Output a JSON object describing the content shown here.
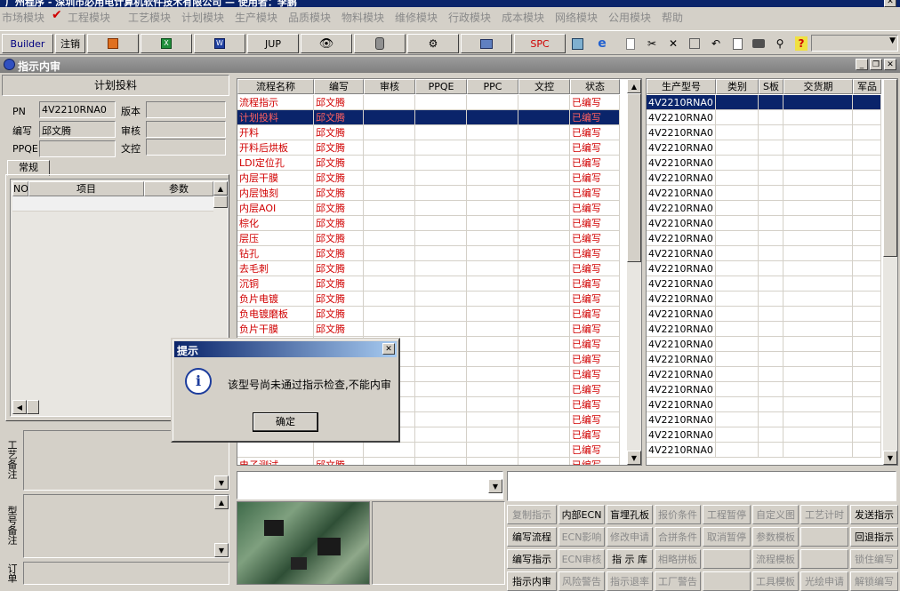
{
  "app": {
    "title": "广州程序 - 深圳市必用电计算机软件技术有限公司 — 使用者：李鹏"
  },
  "menu": [
    "市场模块",
    "工程模块",
    "工艺模块",
    "计划模块",
    "生产模块",
    "品质模块",
    "物料模块",
    "维修模块",
    "行政模块",
    "成本模块",
    "网络模块",
    "公用模块",
    "帮助"
  ],
  "toolbar": {
    "builder": "Builder",
    "logout": "注销",
    "jup": "JUP",
    "spc": "SPC",
    "combo_value": ""
  },
  "window": {
    "title": "指示内审"
  },
  "left": {
    "section_title": "计划投料",
    "pn_label": "PN",
    "pn_value": "4V2210RNA0",
    "version_label": "版本",
    "version_value": "",
    "writer_label": "编写",
    "writer_value": "邱文腾",
    "review_label": "审核",
    "review_value": "",
    "ppqe_label": "PPQE",
    "ppqe_value": "",
    "doc_label": "文控",
    "doc_value": "",
    "tab": "常规",
    "param_headers": [
      "NO",
      "项目",
      "参数"
    ],
    "craft_note_label": "工艺备注",
    "model_note_label": "型号备注",
    "order_note_label": "订单"
  },
  "flow": {
    "headers": [
      "流程名称",
      "编写",
      "审核",
      "PPQE",
      "PPC",
      "文控",
      "状态"
    ],
    "rows": [
      [
        "流程指示",
        "邱文腾",
        "已编写"
      ],
      [
        "计划投料",
        "邱文腾",
        "已编写"
      ],
      [
        "开料",
        "邱文腾",
        "已编写"
      ],
      [
        "开料后烘板",
        "邱文腾",
        "已编写"
      ],
      [
        "LDI定位孔",
        "邱文腾",
        "已编写"
      ],
      [
        "内层干膜",
        "邱文腾",
        "已编写"
      ],
      [
        "内层蚀刻",
        "邱文腾",
        "已编写"
      ],
      [
        "内层AOI",
        "邱文腾",
        "已编写"
      ],
      [
        "棕化",
        "邱文腾",
        "已编写"
      ],
      [
        "层压",
        "邱文腾",
        "已编写"
      ],
      [
        "钻孔",
        "邱文腾",
        "已编写"
      ],
      [
        "去毛刺",
        "邱文腾",
        "已编写"
      ],
      [
        "沉铜",
        "邱文腾",
        "已编写"
      ],
      [
        "负片电镀",
        "邱文腾",
        "已编写"
      ],
      [
        "负电镀磨板",
        "邱文腾",
        "已编写"
      ],
      [
        "负片干膜",
        "邱文腾",
        "已编写"
      ],
      [
        "",
        "",
        "已编写"
      ],
      [
        "",
        "",
        "已编写"
      ],
      [
        "",
        "",
        "已编写"
      ],
      [
        "",
        "",
        "已编写"
      ],
      [
        "",
        "",
        "已编写"
      ],
      [
        "",
        "",
        "已编写"
      ],
      [
        "",
        "",
        "已编写"
      ],
      [
        "",
        "",
        "已编写"
      ],
      [
        "电子测试",
        "邱文腾",
        "已编写"
      ]
    ],
    "selected_index": 1
  },
  "models": {
    "headers": [
      "生产型号",
      "类别",
      "S板",
      "交货期",
      "军品"
    ],
    "rows": [
      "4V2210RNA0",
      "4V2210RNA0",
      "4V2210RNA0",
      "4V2210RNA0",
      "4V2210RNA0",
      "4V2210RNA0",
      "4V2210RNA0",
      "4V2210RNA0",
      "4V2210RNA0",
      "4V2210RNA0",
      "4V2210RNA0",
      "4V2210RNA0",
      "4V2210RNA0",
      "4V2210RNA0",
      "4V2210RNA0",
      "4V2210RNA0",
      "4V2210RNA0",
      "4V2210RNA0",
      "4V2210RNA0",
      "4V2210RNA0",
      "4V2210RNA0",
      "4V2210RNA0",
      "4V2210RNA0",
      "4V2210RNA0"
    ]
  },
  "actions": [
    [
      "复制指示",
      "内部ECN",
      "盲埋孔板",
      "报价条件",
      "工程暂停",
      "自定义图",
      "工艺计时",
      "发送指示"
    ],
    [
      "编写流程",
      "ECN影响",
      "修改申请",
      "合拼条件",
      "取消暂停",
      "参数模板",
      "",
      "回退指示"
    ],
    [
      "编写指示",
      "ECN审核",
      "指 示 库",
      "相略拼板",
      "",
      "流程模板",
      "",
      "锁住编写"
    ],
    [
      "指示内审",
      "风险警告",
      "指示退率",
      "工厂警告",
      "",
      "工具模板",
      "光绘申请",
      "解锁编写"
    ]
  ],
  "actions_disabled": [
    [
      true,
      false,
      false,
      true,
      true,
      true,
      true,
      false
    ],
    [
      false,
      true,
      true,
      true,
      true,
      true,
      false,
      false
    ],
    [
      false,
      true,
      false,
      true,
      false,
      true,
      false,
      true
    ],
    [
      false,
      true,
      true,
      true,
      false,
      true,
      true,
      true
    ]
  ],
  "dialog": {
    "title": "提示",
    "message": "该型号尚未通过指示检查,不能内审",
    "ok": "确定"
  },
  "colors": {
    "selection": "#0a246a",
    "flow_text": "#d00000",
    "title_bar": "#0a246a"
  }
}
